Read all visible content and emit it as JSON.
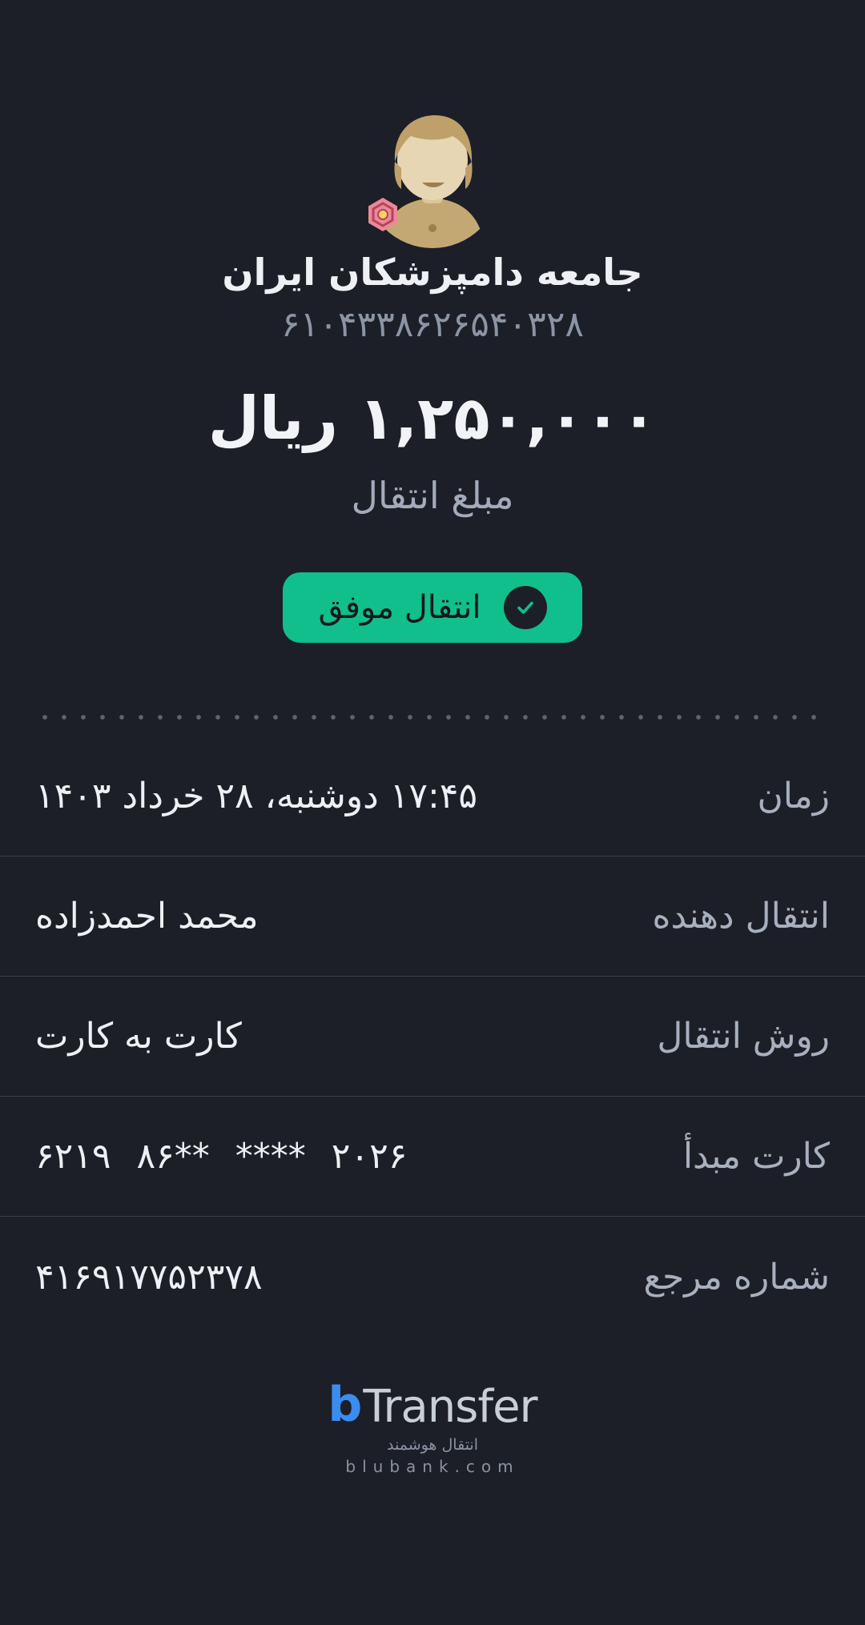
{
  "recipient": {
    "name": "جامعه دامپزشکان ایران",
    "card_number": "۶۱۰۴۳۳۸۶۲۶۵۴۰۳۲۸"
  },
  "transfer": {
    "amount": "۱,۲۵۰,۰۰۰ ریال",
    "amount_label": "مبلغ انتقال",
    "status_label": "انتقال موفق"
  },
  "details": {
    "time_label": "زمان",
    "time_value": "۱۷:۴۵ دوشنبه، ۲۸ خرداد ۱۴۰۳",
    "sender_label": "انتقال دهنده",
    "sender_value": "محمد احمدزاده",
    "method_label": "روش انتقال",
    "method_value": "کارت به کارت",
    "source_card_label": "کارت مبدأ",
    "source_card_groups": [
      "۶۲۱۹",
      "۸۶**",
      "****",
      "۲۰۲۶"
    ],
    "reference_label": "شماره مرجع",
    "reference_value": "۴۱۶۹۱۷۷۵۲۳۷۸"
  },
  "logo": {
    "b": "b",
    "word": "Transfer",
    "tagline": "انتقال هوشمند",
    "domain": "blubank.com"
  },
  "colors": {
    "background": "#1c1f27",
    "success": "#10bf8c",
    "brand_blue": "#3b8cf0"
  },
  "icons": {
    "avatar": "user-avatar-icon",
    "bank": "bank-logo-icon",
    "status": "check-circle-icon"
  }
}
